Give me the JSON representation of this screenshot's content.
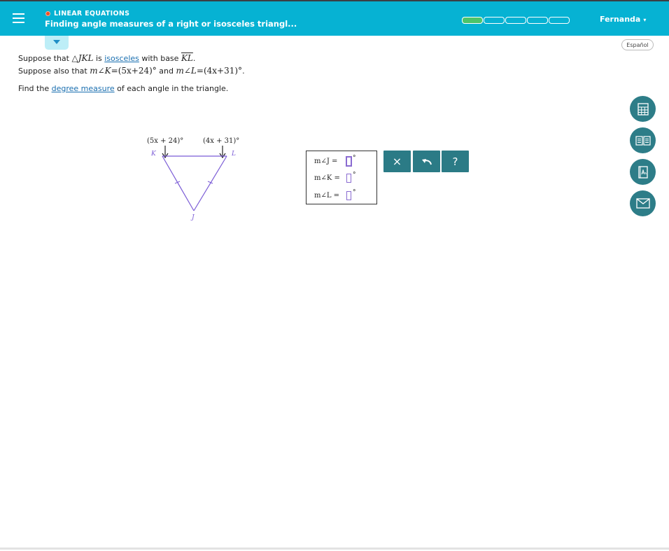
{
  "header": {
    "topic": "LINEAR EQUATIONS",
    "title": "Finding angle measures of a right or isosceles triangl...",
    "progress": {
      "total_segments": 5,
      "filled_segments": 1
    },
    "user_name": "Fernanda",
    "user_caret": "▾"
  },
  "language_button": "Español",
  "problem": {
    "l1_a": "Suppose that ",
    "l1_tri": "△",
    "l1_name": "JKL",
    "l1_b": " is ",
    "l1_link": "isosceles",
    "l1_c": " with base ",
    "l1_base": "KL",
    "l1_d": ".",
    "l2_a": "Suppose also that ",
    "l2_m1": "m∠K",
    "l2_eq1": "=(5x+24)°",
    "l2_and": " and ",
    "l2_m2": "m∠L",
    "l2_eq2": "=(4x+31)°",
    "l2_end": ".",
    "l3_a": "Find the ",
    "l3_link": "degree measure",
    "l3_b": " of each angle in the triangle."
  },
  "figure": {
    "label_k_angle": "(5x + 24)°",
    "label_l_angle": "(4x + 31)°",
    "vertex_k": "K",
    "vertex_l": "L",
    "vertex_j": "J"
  },
  "answers": [
    {
      "label": "m∠J =",
      "value": "",
      "unit": "°"
    },
    {
      "label": "m∠K =",
      "value": "",
      "unit": "°"
    },
    {
      "label": "m∠L =",
      "value": "",
      "unit": "°"
    }
  ],
  "tools": {
    "clear": "×",
    "undo": "↶",
    "help": "?"
  },
  "side_tools": [
    "calculator-icon",
    "textbook-icon",
    "dictionary-icon",
    "message-icon"
  ]
}
